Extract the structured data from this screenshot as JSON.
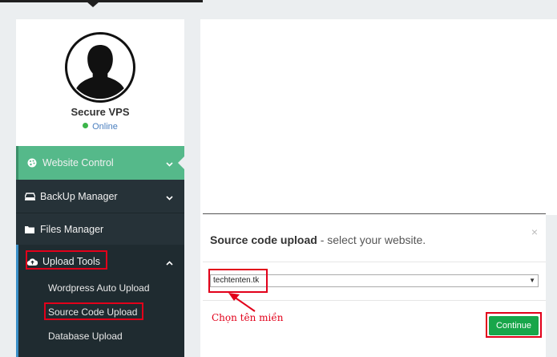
{
  "profile": {
    "name": "Secure VPS",
    "status": "Online",
    "avatar_icon": "user-silhouette-icon"
  },
  "menu": {
    "website_control": "Website Control",
    "backup_manager": "BackUp Manager",
    "files_manager": "Files Manager",
    "upload_tools": "Upload Tools",
    "sub_items": [
      "Wordpress Auto Upload",
      "Source Code Upload",
      "Database Upload"
    ]
  },
  "modal": {
    "title_bold": "Source code upload",
    "title_rest": " - select your website.",
    "close": "×",
    "selected_site": "techtenten.tk",
    "continue_label": "Continue"
  },
  "annotation": {
    "hint": "Chọn tên miền"
  },
  "colors": {
    "accent_green": "#55b98a",
    "sidebar_dark": "#263238",
    "highlight_red": "#e2001a",
    "button_green": "#18a64a"
  }
}
